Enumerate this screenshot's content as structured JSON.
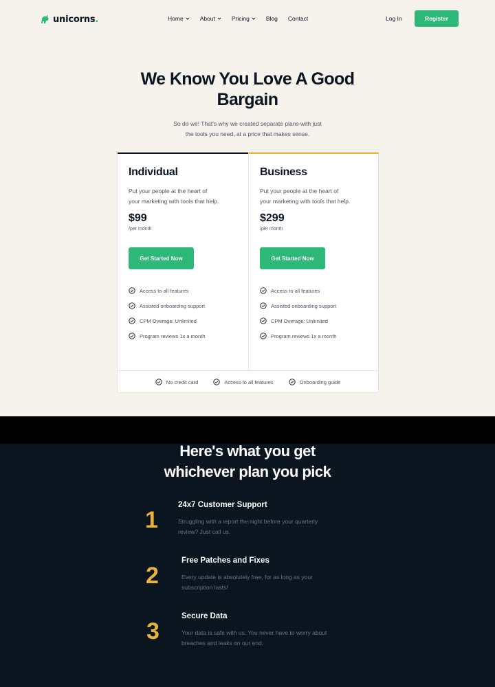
{
  "brand": {
    "name": "unicorns",
    "dot": ".",
    "accent": "#2db87a"
  },
  "nav": {
    "items": [
      {
        "label": "Home",
        "has_dropdown": true
      },
      {
        "label": "About",
        "has_dropdown": true
      },
      {
        "label": "Pricing",
        "has_dropdown": true
      },
      {
        "label": "Blog",
        "has_dropdown": false
      },
      {
        "label": "Contact",
        "has_dropdown": false
      }
    ],
    "login_label": "Log In",
    "register_label": "Register"
  },
  "hero": {
    "title_line1": "We Know You Love A Good",
    "title_line2": "Bargain",
    "subtitle_line1": "So do we! That's why we created separate plans with just",
    "subtitle_line2": "the tools you need, at a price that makes sense."
  },
  "plans": [
    {
      "name": "Individual",
      "desc_line1": "Put your people at the heart of",
      "desc_line2": "your marketing with tools that help.",
      "price": "$99",
      "period": "/per month",
      "cta": "Get Started Now",
      "features": [
        "Access to all features",
        "Assisted onboarding support",
        "CPM Overage: Unlimited",
        "Program reviews 1x a month"
      ]
    },
    {
      "name": "Business",
      "desc_line1": "Put your people at the heart of",
      "desc_line2": "your marketing with tools that help.",
      "price": "$299",
      "period": "/per month",
      "cta": "Get Started Now",
      "features": [
        "Access to all features",
        "Assisted onboarding support",
        "CPM Overage: Unlimited",
        "Program reviews 1x a month"
      ]
    }
  ],
  "pricing_footer": [
    "No credit card",
    "Access to all features",
    "Onboarding guide"
  ],
  "benefits_section": {
    "title_line1": "Here's what you get",
    "title_line2": "whichever plan you pick",
    "items": [
      {
        "number": "1",
        "title": "24x7 Customer Support",
        "desc_line1": "Struggling with a report the night before your quarterly",
        "desc_line2": "review? Just call us."
      },
      {
        "number": "2",
        "title": "Free Patches and Fixes",
        "desc_line1": "Every update is absolutely free, for as long as your",
        "desc_line2": "subscription lasts!"
      },
      {
        "number": "3",
        "title": "Secure Data",
        "desc_line1": "Your data is safe with us. You never have to worry about",
        "desc_line2": "breaches and leaks on our end."
      }
    ]
  },
  "colors": {
    "green": "#2db87a",
    "gold": "#e9b33b",
    "navy": "#0a1520",
    "cream": "#f6f3ec"
  }
}
